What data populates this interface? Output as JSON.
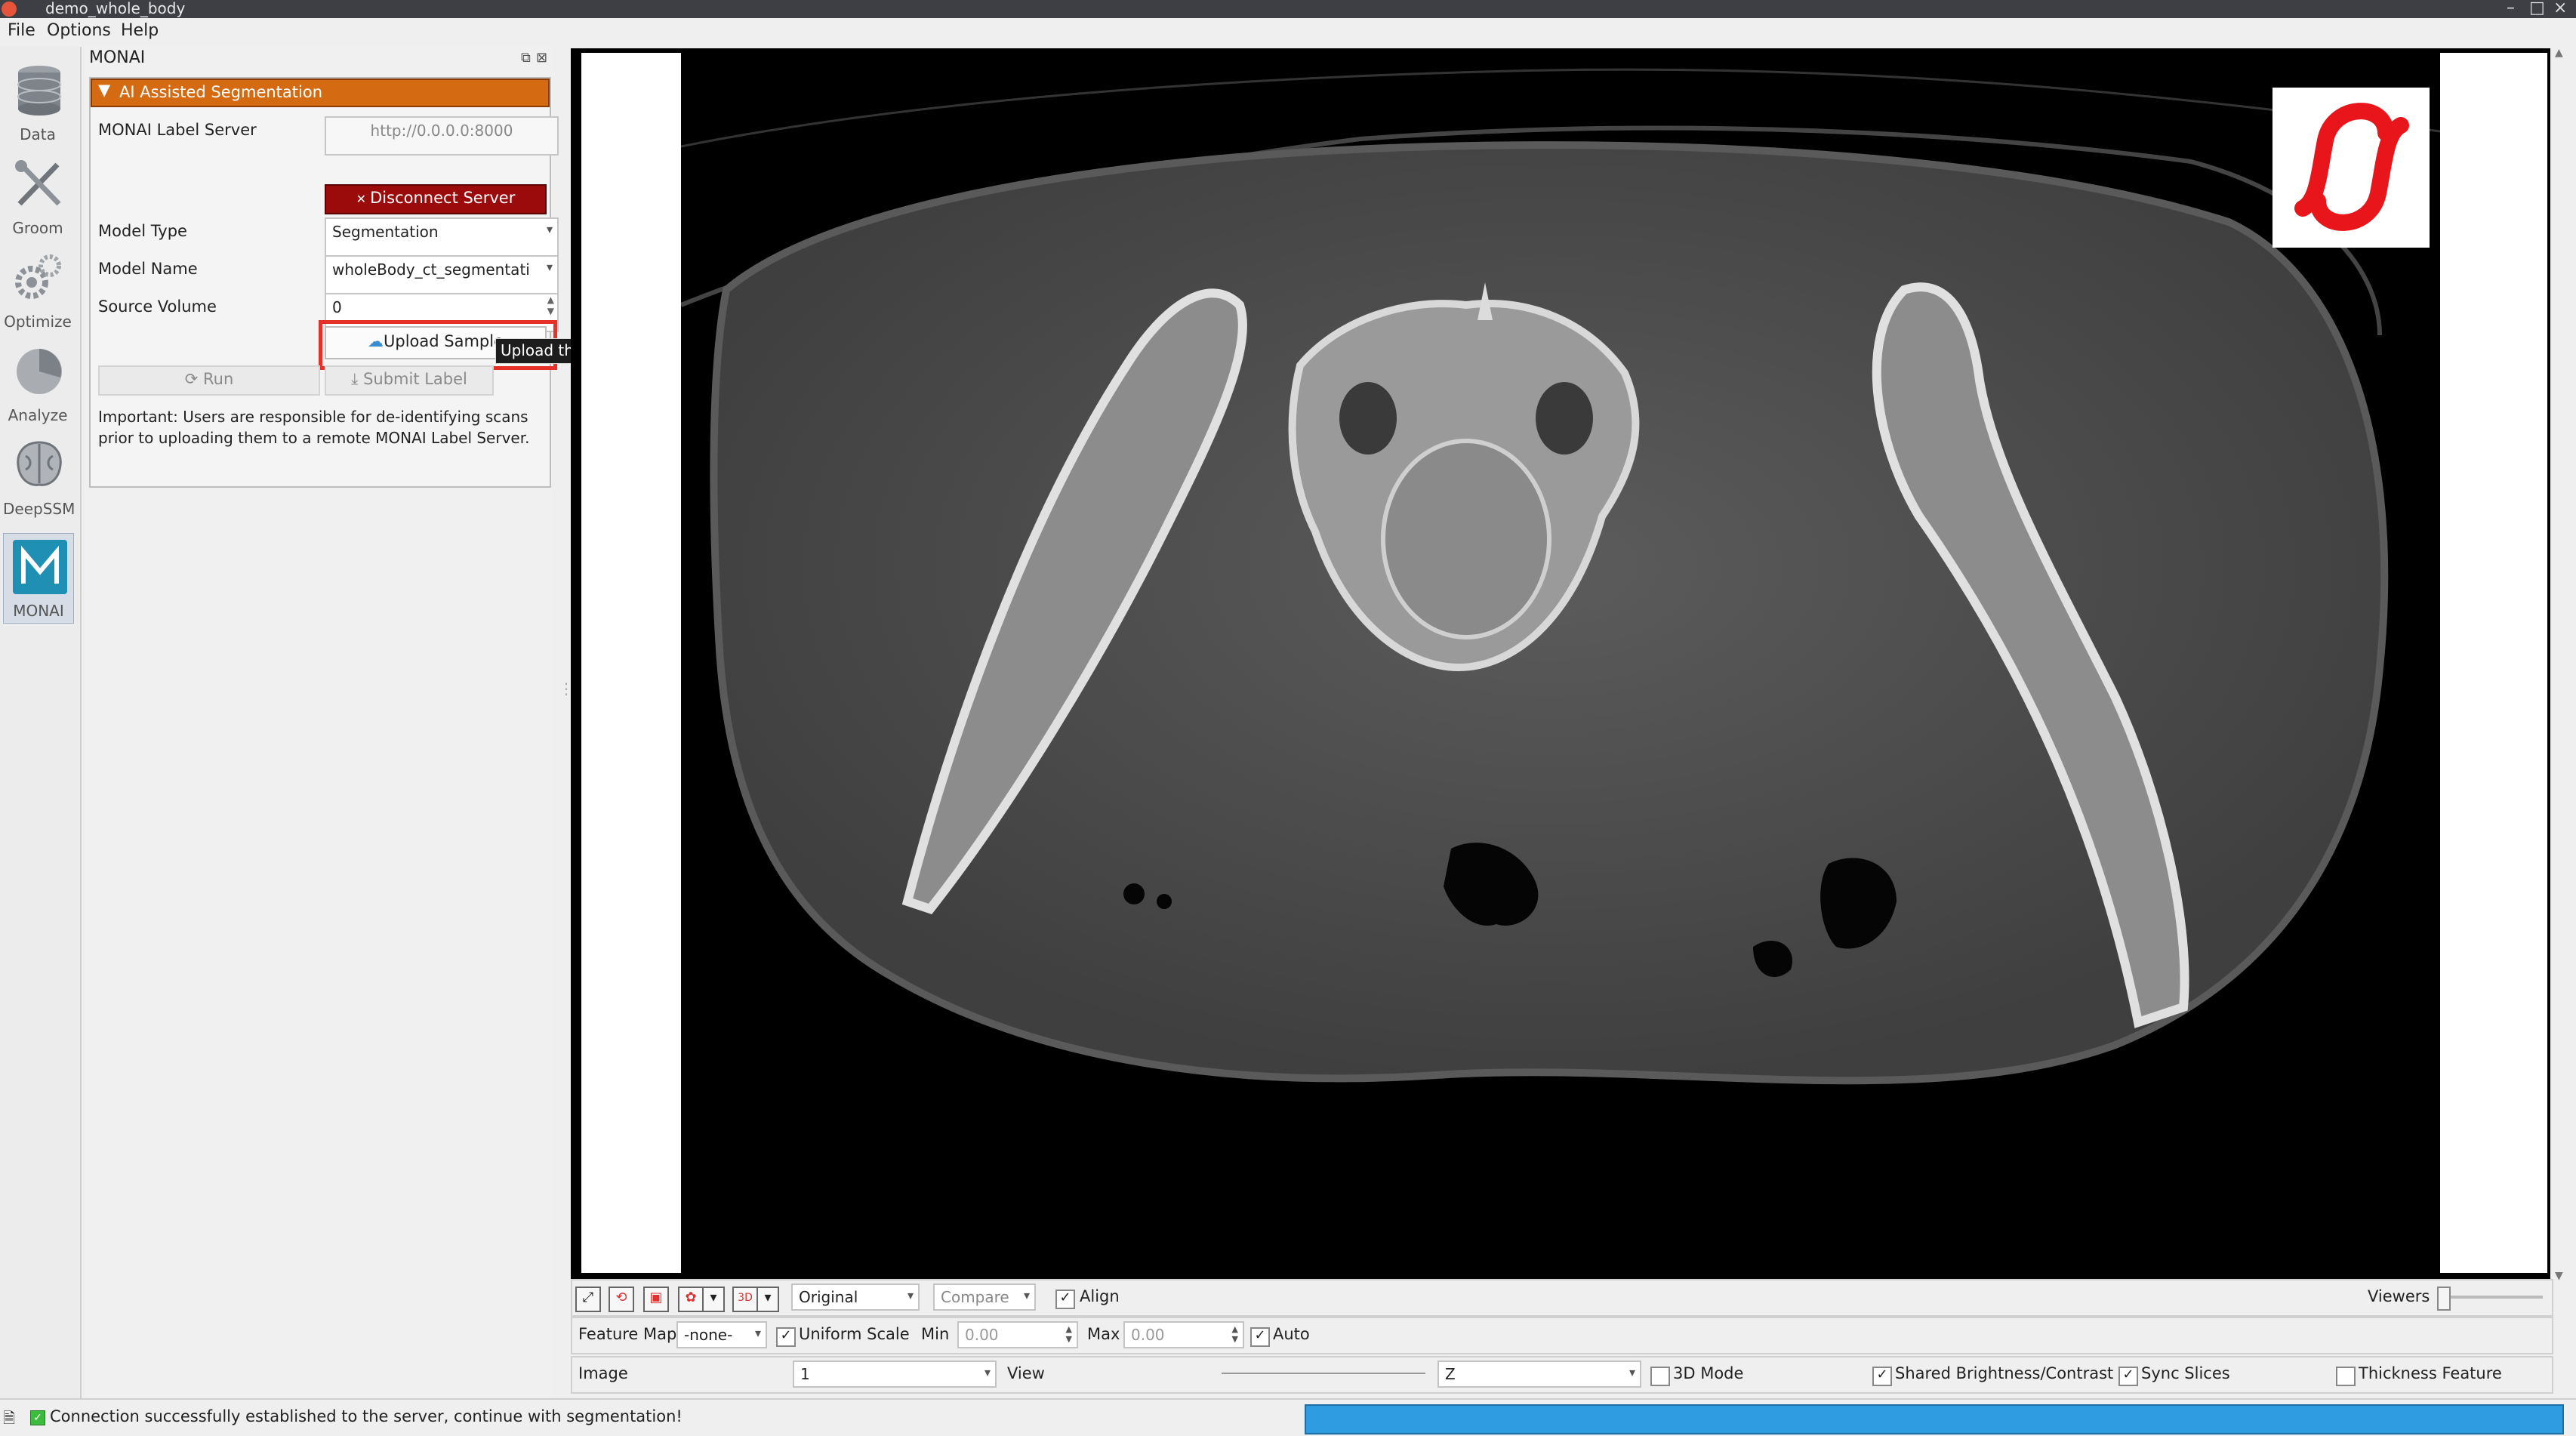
{
  "window": {
    "title": "demo_whole_body"
  },
  "menu": [
    "File",
    "Options",
    "Help"
  ],
  "modules": [
    {
      "label": "Data",
      "icon": "database-icon"
    },
    {
      "label": "Groom",
      "icon": "tools-icon"
    },
    {
      "label": "Optimize",
      "icon": "gears-icon"
    },
    {
      "label": "Analyze",
      "icon": "chart-sphere-icon"
    },
    {
      "label": "DeepSSM",
      "icon": "brain-icon"
    },
    {
      "label": "MONAI",
      "icon": "monai-icon",
      "active": true
    }
  ],
  "panel": {
    "title": "MONAI",
    "group_title": "AI Assisted Segmentation",
    "server_label": "MONAI Label Server",
    "server_url": "http://0.0.0.0:8000",
    "disconnect_label": "Disconnect Server",
    "model_type_label": "Model Type",
    "model_type_value": "Segmentation",
    "model_name_label": "Model Name",
    "model_name_value": "wholeBody_ct_segmentati",
    "source_volume_label": "Source Volume",
    "source_volume_value": "0",
    "upload_label": "Upload Sample",
    "run_label": "Run",
    "submit_label": "Submit Label",
    "notice": "Important: Users are responsible for de-identifying scans prior to uploading them to a remote MONAI Label Server."
  },
  "tooltip": "Upload the selected volume to the server.",
  "toolbar1": {
    "mode_value": "Original",
    "compare_value": "Compare",
    "align_label": "Align",
    "align_checked": true,
    "viewers_label": "Viewers"
  },
  "toolbar2": {
    "feature_map_label": "Feature Map",
    "feature_map_value": "-none-",
    "uniform_scale_label": "Uniform Scale",
    "min_label": "Min",
    "min_value": "0.00",
    "max_label": "Max",
    "max_value": "0.00",
    "auto_label": "Auto"
  },
  "toolbar3": {
    "image_label": "Image",
    "image_value": "1",
    "view_label": "View",
    "axis_value": "Z",
    "mode3d_label": "3D Mode",
    "shared_bc_label": "Shared Brightness/Contrast",
    "sync_slices_label": "Sync Slices",
    "thickness_label": "Thickness Feature"
  },
  "status": {
    "message": "Connection successfully established to the server, continue with segmentation!",
    "progress": 1.0
  },
  "colors": {
    "accent_header": "#d46a11",
    "disconnect": "#9b0b0b",
    "highlight": "#e53127",
    "progress": "#2f9be0"
  }
}
